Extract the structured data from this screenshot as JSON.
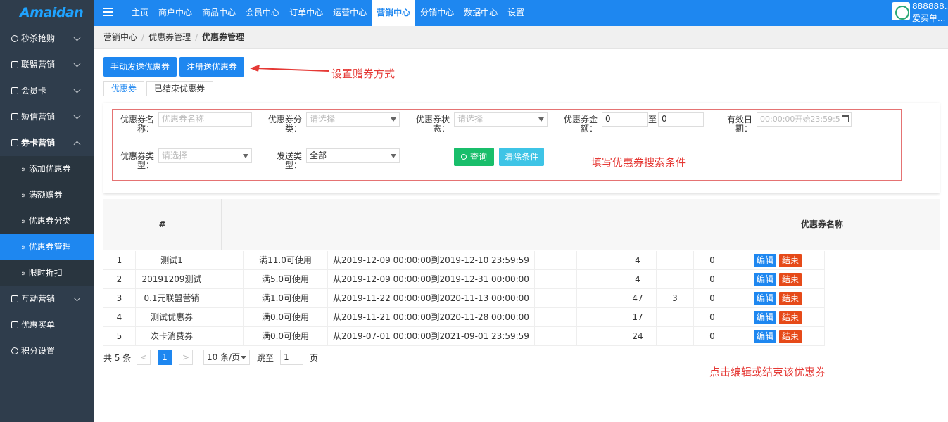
{
  "app": {
    "logo": "Amaidan"
  },
  "topnav": {
    "items": [
      "主页",
      "商户中心",
      "商品中心",
      "会员中心",
      "订单中心",
      "运营中心",
      "营销中心",
      "分销中心",
      "数据中心",
      "设置"
    ],
    "active_index": 6
  },
  "user": {
    "name": "888888...",
    "sub": "爱买单..."
  },
  "sidebar": {
    "items": [
      {
        "label": "秒杀抢购",
        "icon": "clock-icon"
      },
      {
        "label": "联盟营销",
        "icon": "gift-icon"
      },
      {
        "label": "会员卡",
        "icon": "card-icon"
      },
      {
        "label": "短信营销",
        "icon": "message-icon"
      },
      {
        "label": "券卡营销",
        "icon": "tag-icon"
      },
      {
        "label": "互动营销",
        "icon": "network-icon"
      },
      {
        "label": "优惠买单",
        "icon": "briefcase-icon"
      },
      {
        "label": "积分设置",
        "icon": "database-icon"
      }
    ],
    "sub_items": [
      "添加优惠券",
      "满额赠券",
      "优惠券分类",
      "优惠券管理",
      "限时折扣"
    ],
    "active_sub": "优惠券管理"
  },
  "breadcrumb": [
    "营销中心",
    "优惠券管理",
    "优惠券管理"
  ],
  "actions": {
    "manual_send": "手动发送优惠券",
    "register_send": "注册送优惠券"
  },
  "annotations": {
    "send_method": "设置赠券方式",
    "search_hint": "填写优惠券搜索条件",
    "edit_hint": "点击编辑或结束该优惠券"
  },
  "tabs": [
    "优惠券",
    "已结束优惠券"
  ],
  "search": {
    "name_label": "优惠券名称：",
    "name_placeholder": "优惠券名称",
    "category_label": "优惠券分类：",
    "category_placeholder": "请选择",
    "status_label": "优惠券状态：",
    "status_placeholder": "请选择",
    "amount_label": "优惠券金额：",
    "amount_from": "0",
    "amount_to_label": "至",
    "amount_to": "0",
    "validity_label": "有效日期：",
    "validity_placeholder": "00:00:00开始23:59:5",
    "type_label": "优惠券类型：",
    "type_placeholder": "请选择",
    "send_type_label": "发送类型：",
    "send_type_value": "全部",
    "query_button": "查询",
    "clear_button": "清除条件"
  },
  "table": {
    "headers": {
      "index": "#",
      "name": "优惠券名称"
    },
    "edit_label": "编辑",
    "end_label": "结束",
    "rows": [
      {
        "idx": "1",
        "name": "测试1",
        "cond": "满11.0可使用",
        "period": "从2019-12-09 00:00:00到2019-12-10 23:59:59",
        "n1": "4",
        "n2": "",
        "n3": "0"
      },
      {
        "idx": "2",
        "name": "20191209测试",
        "cond": "满5.0可使用",
        "period": "从2019-12-09 00:00:00到2019-12-31 00:00:00",
        "n1": "4",
        "n2": "",
        "n3": "0"
      },
      {
        "idx": "3",
        "name": "0.1元联盟营销",
        "cond": "满1.0可使用",
        "period": "从2019-11-22 00:00:00到2020-11-13 00:00:00",
        "n1": "47",
        "n2": "3",
        "n3": "0"
      },
      {
        "idx": "4",
        "name": "测试优惠券",
        "cond": "满0.0可使用",
        "period": "从2019-11-21 00:00:00到2020-11-28 00:00:00",
        "n1": "17",
        "n2": "",
        "n3": "0"
      },
      {
        "idx": "5",
        "name": "次卡消费券",
        "cond": "满0.0可使用",
        "period": "从2019-07-01 00:00:00到2021-09-01 23:59:59",
        "n1": "24",
        "n2": "",
        "n3": "0"
      }
    ]
  },
  "pager": {
    "total": "共 5 条",
    "prev": "<",
    "page": "1",
    "next": ">",
    "size": "10 条/页",
    "goto_label": "跳至",
    "goto_value": "1",
    "page_suffix": "页"
  }
}
